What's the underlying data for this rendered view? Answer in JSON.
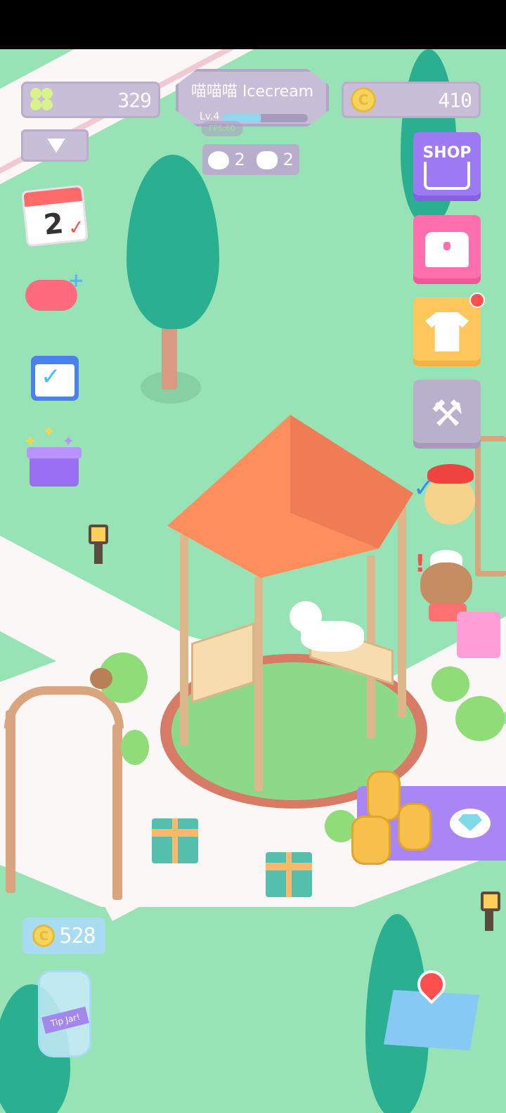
{
  "hud": {
    "clover_count": "329",
    "coin_count": "410",
    "player_name": "喵喵喵 Icecream",
    "level_label": "Lv.4",
    "level_progress": 0.45,
    "fps_label": "FPS:60",
    "dog_count": "2",
    "cat_count": "2"
  },
  "left_menu": {
    "calendar_day": "2"
  },
  "right_menu": {
    "shop_label": "SHOP",
    "notification_dot": true
  },
  "tip_jar": {
    "coin_count": "528",
    "jar_label": "Tip Jar!"
  },
  "colors": {
    "lawn": "#98e3b5",
    "path": "#faf7f6",
    "hud_panel": "#c8bed8",
    "shop": "#9d79f4",
    "chest": "#ff6fae",
    "shirt": "#ffc65c",
    "tools": "#b9b0cc"
  },
  "icons": [
    "clover-icon",
    "coin-icon",
    "dog-face-icon",
    "cat-face-icon",
    "calendar-icon",
    "gamepad-icon",
    "check-calendar-icon",
    "gift-box-icon",
    "shopping-cart-icon",
    "treasure-chest-icon",
    "t-shirt-icon",
    "hammer-wrench-icon",
    "map-icon",
    "diamond-icon"
  ]
}
